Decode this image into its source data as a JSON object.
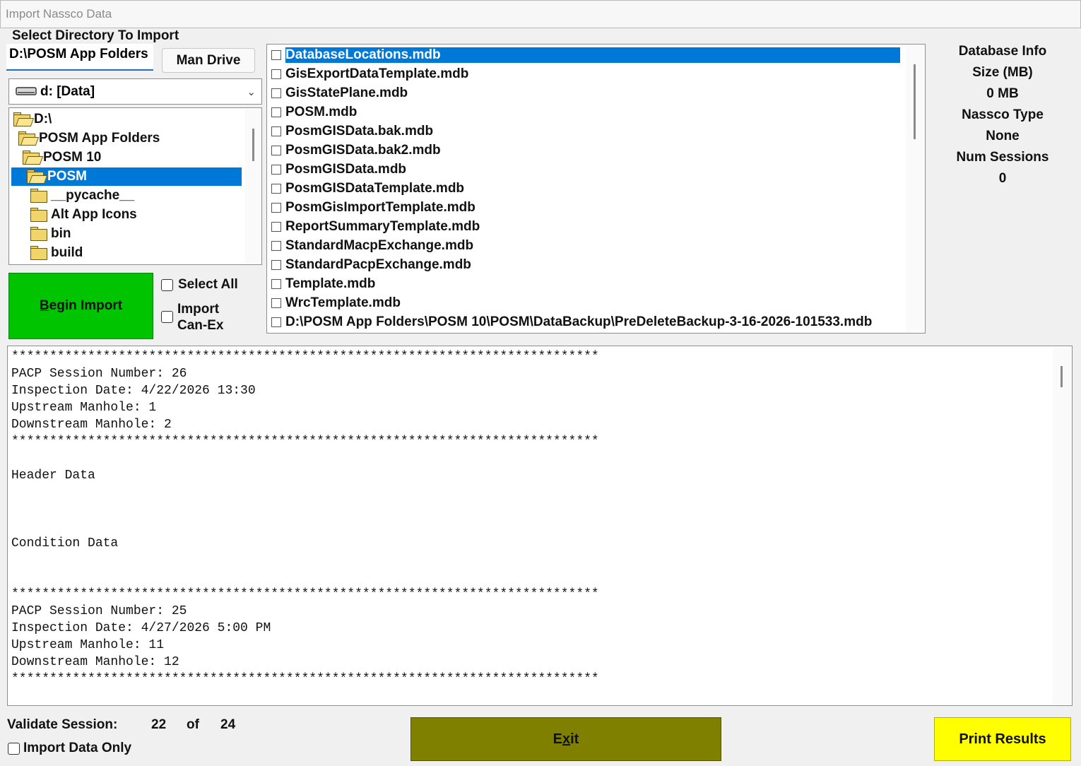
{
  "window": {
    "title": "Import Nassco Data"
  },
  "directory": {
    "label": "Select Directory To Import",
    "path_value": "D:\\POSM App Folders",
    "man_drive_label": "Man Drive",
    "drive_value": "d: [Data]"
  },
  "tree": {
    "items": [
      {
        "label": "D:\\",
        "level": 0,
        "open": true,
        "selected": false
      },
      {
        "label": "POSM App Folders",
        "level": 1,
        "open": true,
        "selected": false
      },
      {
        "label": "POSM 10",
        "level": 2,
        "open": true,
        "selected": false
      },
      {
        "label": "POSM",
        "level": 3,
        "open": true,
        "selected": true
      },
      {
        "label": "__pycache__",
        "level": 4,
        "open": false,
        "selected": false
      },
      {
        "label": "Alt App Icons",
        "level": 4,
        "open": false,
        "selected": false
      },
      {
        "label": "bin",
        "level": 4,
        "open": false,
        "selected": false
      },
      {
        "label": "build",
        "level": 4,
        "open": false,
        "selected": false
      }
    ]
  },
  "actions": {
    "begin_import_prefix": "B",
    "begin_import_rest": "egin Import",
    "select_all_label": "Select All",
    "import_canex_line1": "Import",
    "import_canex_line2": "Can-Ex"
  },
  "files": {
    "items": [
      "DatabaseLocations.mdb",
      "GisExportDataTemplate.mdb",
      "GisStatePlane.mdb",
      "POSM.mdb",
      "PosmGISData.bak.mdb",
      "PosmGISData.bak2.mdb",
      "PosmGISData.mdb",
      "PosmGISDataTemplate.mdb",
      "PosmGisImportTemplate.mdb",
      "ReportSummaryTemplate.mdb",
      "StandardMacpExchange.mdb",
      "StandardPacpExchange.mdb",
      "Template.mdb",
      "WrcTemplate.mdb",
      "D:\\POSM App Folders\\POSM 10\\POSM\\DataBackup\\PreDeleteBackup-3-16-2026-101533.mdb"
    ]
  },
  "info": {
    "title": "Database Info",
    "size_label": "Size (MB)",
    "size_value": "0 MB",
    "type_label": "Nassco Type",
    "type_value": "None",
    "sessions_label": "Num Sessions",
    "sessions_value": "0"
  },
  "log": {
    "lines": [
      "*****************************************************************************",
      "PACP Session Number: 26",
      "Inspection Date: 4/22/2026 13:30",
      "Upstream Manhole: 1",
      "Downstream Manhole: 2",
      "*****************************************************************************",
      "",
      "Header Data",
      "",
      "",
      "",
      "Condition Data",
      "",
      "",
      "*****************************************************************************",
      "PACP Session Number: 25",
      "Inspection Date: 4/27/2026 5:00 PM",
      "Upstream Manhole: 11",
      "Downstream Manhole: 12",
      "*****************************************************************************"
    ]
  },
  "footer": {
    "validate_label": "Validate Session:",
    "session_current": "22",
    "of_label": "of",
    "session_total": "24",
    "import_only_label": "Import Data Only",
    "exit_prefix": "E",
    "exit_hot": "x",
    "exit_rest": "it",
    "print_label": "Print Results"
  },
  "colors": {
    "begin_import_bg": "#00c400",
    "exit_bg": "#808000",
    "print_bg": "#ffff00",
    "selection": "#0078d7"
  }
}
